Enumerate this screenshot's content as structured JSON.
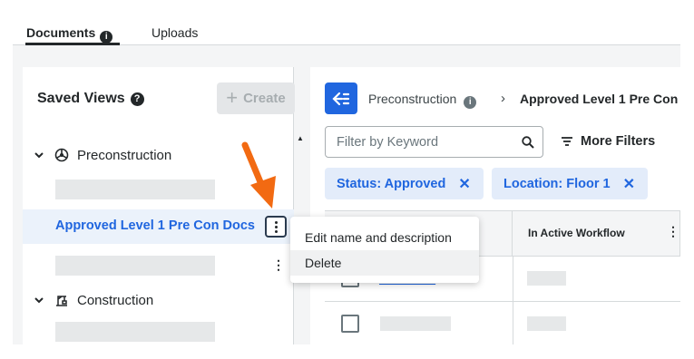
{
  "tabs": {
    "documents": "Documents",
    "uploads": "Uploads"
  },
  "saved_views": {
    "title": "Saved Views",
    "create_label": "Create",
    "groups": [
      {
        "label": "Preconstruction"
      },
      {
        "label": "Construction"
      }
    ],
    "selected_view": "Approved Level 1 Pre Con Docs"
  },
  "context_menu": {
    "items": [
      "Edit name and description",
      "Delete"
    ]
  },
  "breadcrumb": {
    "parent": "Preconstruction",
    "current": "Approved Level 1 Pre Con"
  },
  "filters": {
    "search_placeholder": "Filter by Keyword",
    "more_filters_label": "More Filters",
    "chips": [
      {
        "label": "Status: Approved"
      },
      {
        "label": "Location: Floor 1"
      }
    ]
  },
  "table": {
    "columns": [
      "",
      "In Active Workflow"
    ],
    "rows": [
      {
        "link": "CR-2-ARC"
      },
      {
        "link": ""
      }
    ]
  },
  "colors": {
    "accent": "#2066df",
    "arrow": "#f26a12"
  }
}
